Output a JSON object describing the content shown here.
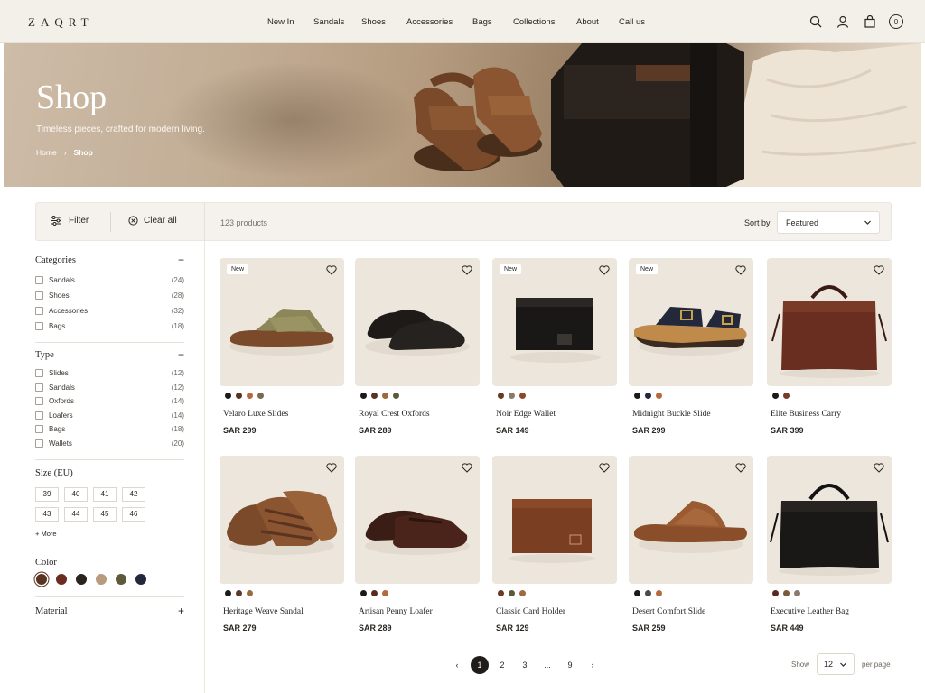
{
  "brand": "ZAQRT",
  "nav": [
    "New In",
    "Sandals",
    "Shoes",
    "Accessories",
    "Bags",
    "Collections",
    "About",
    "Call us"
  ],
  "header": {
    "cart_count": "0"
  },
  "hero": {
    "title": "Shop",
    "subtitle": "Timeless pieces, crafted for modern living.",
    "crumb_home": "Home",
    "crumb_sep": "›",
    "crumb_current": "Shop"
  },
  "toolbar": {
    "filter_label": "Filter",
    "clear_label": "Clear all",
    "product_count": "123 products",
    "sort_label": "Sort by",
    "sort_value": "Featured"
  },
  "sidebar": {
    "categories_title": "Categories",
    "categories": [
      {
        "label": "Sandals",
        "count": "(24)"
      },
      {
        "label": "Shoes",
        "count": "(28)"
      },
      {
        "label": "Accessories",
        "count": "(32)"
      },
      {
        "label": "Bags",
        "count": "(18)"
      }
    ],
    "type_title": "Type",
    "types": [
      {
        "label": "Slides",
        "count": "(12)"
      },
      {
        "label": "Sandals",
        "count": "(12)"
      },
      {
        "label": "Oxfords",
        "count": "(14)"
      },
      {
        "label": "Loafers",
        "count": "(14)"
      },
      {
        "label": "Bags",
        "count": "(18)"
      },
      {
        "label": "Wallets",
        "count": "(20)"
      }
    ],
    "size_title": "Size (EU)",
    "sizes": [
      "39",
      "40",
      "41",
      "42",
      "43",
      "44",
      "45",
      "46"
    ],
    "more_label": "+ More",
    "color_title": "Color",
    "colors": [
      "#5a3420",
      "#6b2d22",
      "#2a2420",
      "#b89a7c",
      "#5c5a3a",
      "#23283a"
    ],
    "material_title": "Material",
    "minus": "−",
    "plus": "+"
  },
  "products": [
    {
      "name": "Velaro Luxe Slides",
      "price": "SAR 299",
      "badge": "New",
      "colors": [
        "#1c1a18",
        "#5a3420",
        "#b46a3c",
        "#7a6a50"
      ]
    },
    {
      "name": "Royal Crest Oxfords",
      "price": "SAR 289",
      "badge": "",
      "colors": [
        "#1c1a18",
        "#5a3420",
        "#9c6a3c",
        "#5c5a3a"
      ]
    },
    {
      "name": "Noir Edge Wallet",
      "price": "SAR 149",
      "badge": "New",
      "colors": [
        "#6b3a22",
        "#8a7c6c",
        "#8a4a2a"
      ]
    },
    {
      "name": "Midnight Buckle Slide",
      "price": "SAR 299",
      "badge": "New",
      "colors": [
        "#1c1a18",
        "#23283a",
        "#b46a3c"
      ]
    },
    {
      "name": "Elite Business Carry",
      "price": "SAR 399",
      "badge": "",
      "colors": [
        "#1c1a18",
        "#7a3a2a"
      ]
    },
    {
      "name": "Heritage Weave Sandal",
      "price": "SAR 279",
      "badge": "",
      "colors": [
        "#1c1a18",
        "#5a3a2a",
        "#9c6a3c"
      ]
    },
    {
      "name": "Artisan Penny Loafer",
      "price": "SAR 289",
      "badge": "",
      "colors": [
        "#1c1a18",
        "#5a2a22",
        "#b46a3c"
      ]
    },
    {
      "name": "Classic Card Holder",
      "price": "SAR 129",
      "badge": "",
      "colors": [
        "#6b3a22",
        "#5c5a3a",
        "#9c6a3c"
      ]
    },
    {
      "name": "Desert Comfort Slide",
      "price": "SAR 259",
      "badge": "",
      "colors": [
        "#1c1a18",
        "#4a4a48",
        "#b46a3c"
      ]
    },
    {
      "name": "Executive Leather Bag",
      "price": "SAR 449",
      "badge": "",
      "colors": [
        "#5a2a22",
        "#7a5a3a",
        "#8a7c6c"
      ]
    }
  ],
  "pagination": {
    "pages": [
      "1",
      "2",
      "3",
      "...",
      "9"
    ],
    "active": "1",
    "prev": "‹",
    "next": "›"
  },
  "per_page": {
    "show_label": "Show",
    "value": "12",
    "suffix": "per page"
  }
}
